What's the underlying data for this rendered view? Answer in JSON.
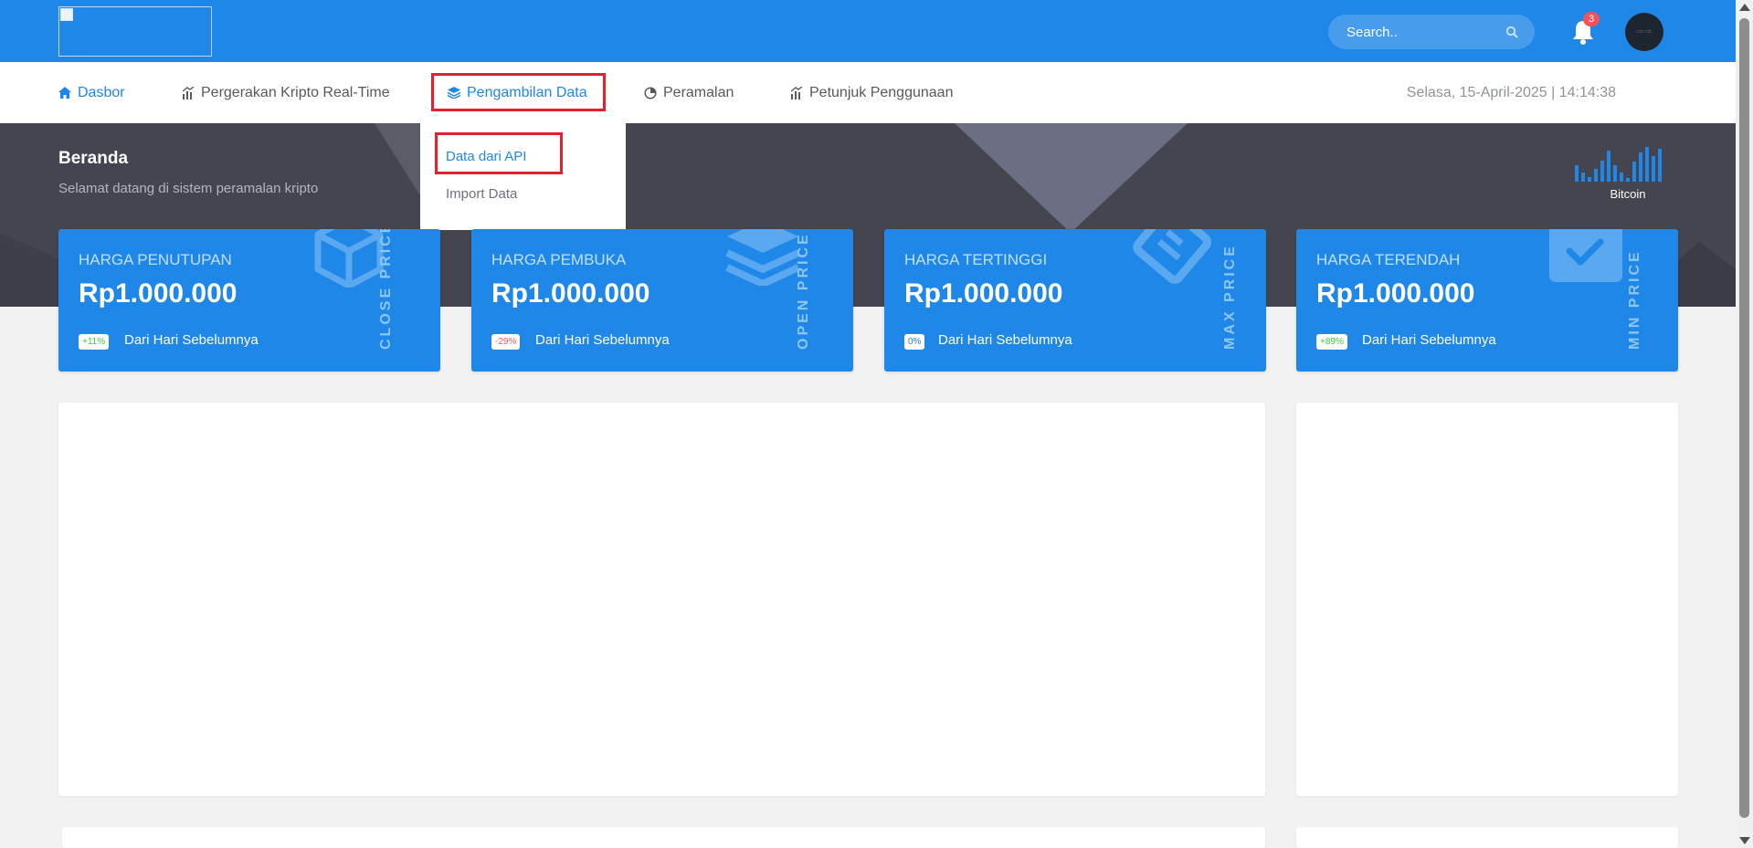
{
  "header": {
    "search_placeholder": "Search..",
    "notification_count": "3",
    "avatar_text": "cdc-cdc"
  },
  "nav": {
    "items": [
      {
        "label": "Dasbor"
      },
      {
        "label": "Pergerakan Kripto Real-Time"
      },
      {
        "label": "Pengambilan Data"
      },
      {
        "label": "Peramalan"
      },
      {
        "label": "Petunjuk Penggunaan"
      }
    ],
    "datetime": "Selasa, 15-April-2025 | 14:14:38",
    "dropdown": {
      "items": [
        {
          "label": "Data dari API"
        },
        {
          "label": "Import Data"
        }
      ]
    }
  },
  "hero": {
    "title": "Beranda",
    "subtitle": "Selamat datang di sistem peramalan kripto",
    "coin_label": "Bitcoin"
  },
  "cards": [
    {
      "title": "HARGA PENUTUPAN",
      "value": "Rp1.000.000",
      "change": "+11%",
      "change_color": "#31ce36",
      "footnote": "Dari Hari Sebelumnya",
      "vertical_label": "CLOSE PRICE",
      "icon": "cube-icon"
    },
    {
      "title": "HARGA PEMBUKA",
      "value": "Rp1.000.000",
      "change": "-29%",
      "change_color": "#f25961",
      "footnote": "Dari Hari Sebelumnya",
      "vertical_label": "OPEN PRICE",
      "icon": "layers-icon"
    },
    {
      "title": "HARGA TERTINGGI",
      "value": "Rp1.000.000",
      "change": "0%",
      "change_color": "#1f87e8",
      "footnote": "Dari Hari Sebelumnya",
      "vertical_label": "MAX PRICE",
      "icon": "tag-icon"
    },
    {
      "title": "HARGA TERENDAH",
      "value": "Rp1.000.000",
      "change": "+89%",
      "change_color": "#31ce36",
      "footnote": "Dari Hari Sebelumnya",
      "vertical_label": "MIN PRICE",
      "icon": "check-square-icon"
    }
  ],
  "colors": {
    "primary": "#1f87e8",
    "hero_bg": "#44454f",
    "highlight": "#e3202b"
  }
}
